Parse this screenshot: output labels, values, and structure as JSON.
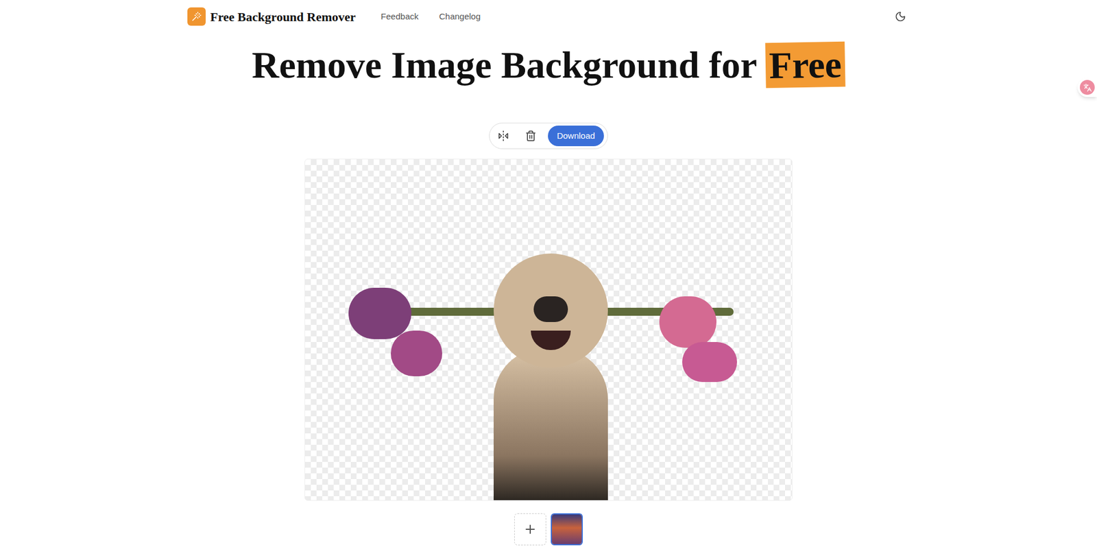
{
  "header": {
    "brand": "Free Background Remover",
    "nav": [
      {
        "label": "Feedback"
      },
      {
        "label": "Changelog"
      }
    ]
  },
  "hero": {
    "title": "Remove Image Background for",
    "highlight": "Free"
  },
  "toolbar": {
    "download": "Download"
  },
  "thumbnails": [
    {
      "selected": true
    }
  ]
}
